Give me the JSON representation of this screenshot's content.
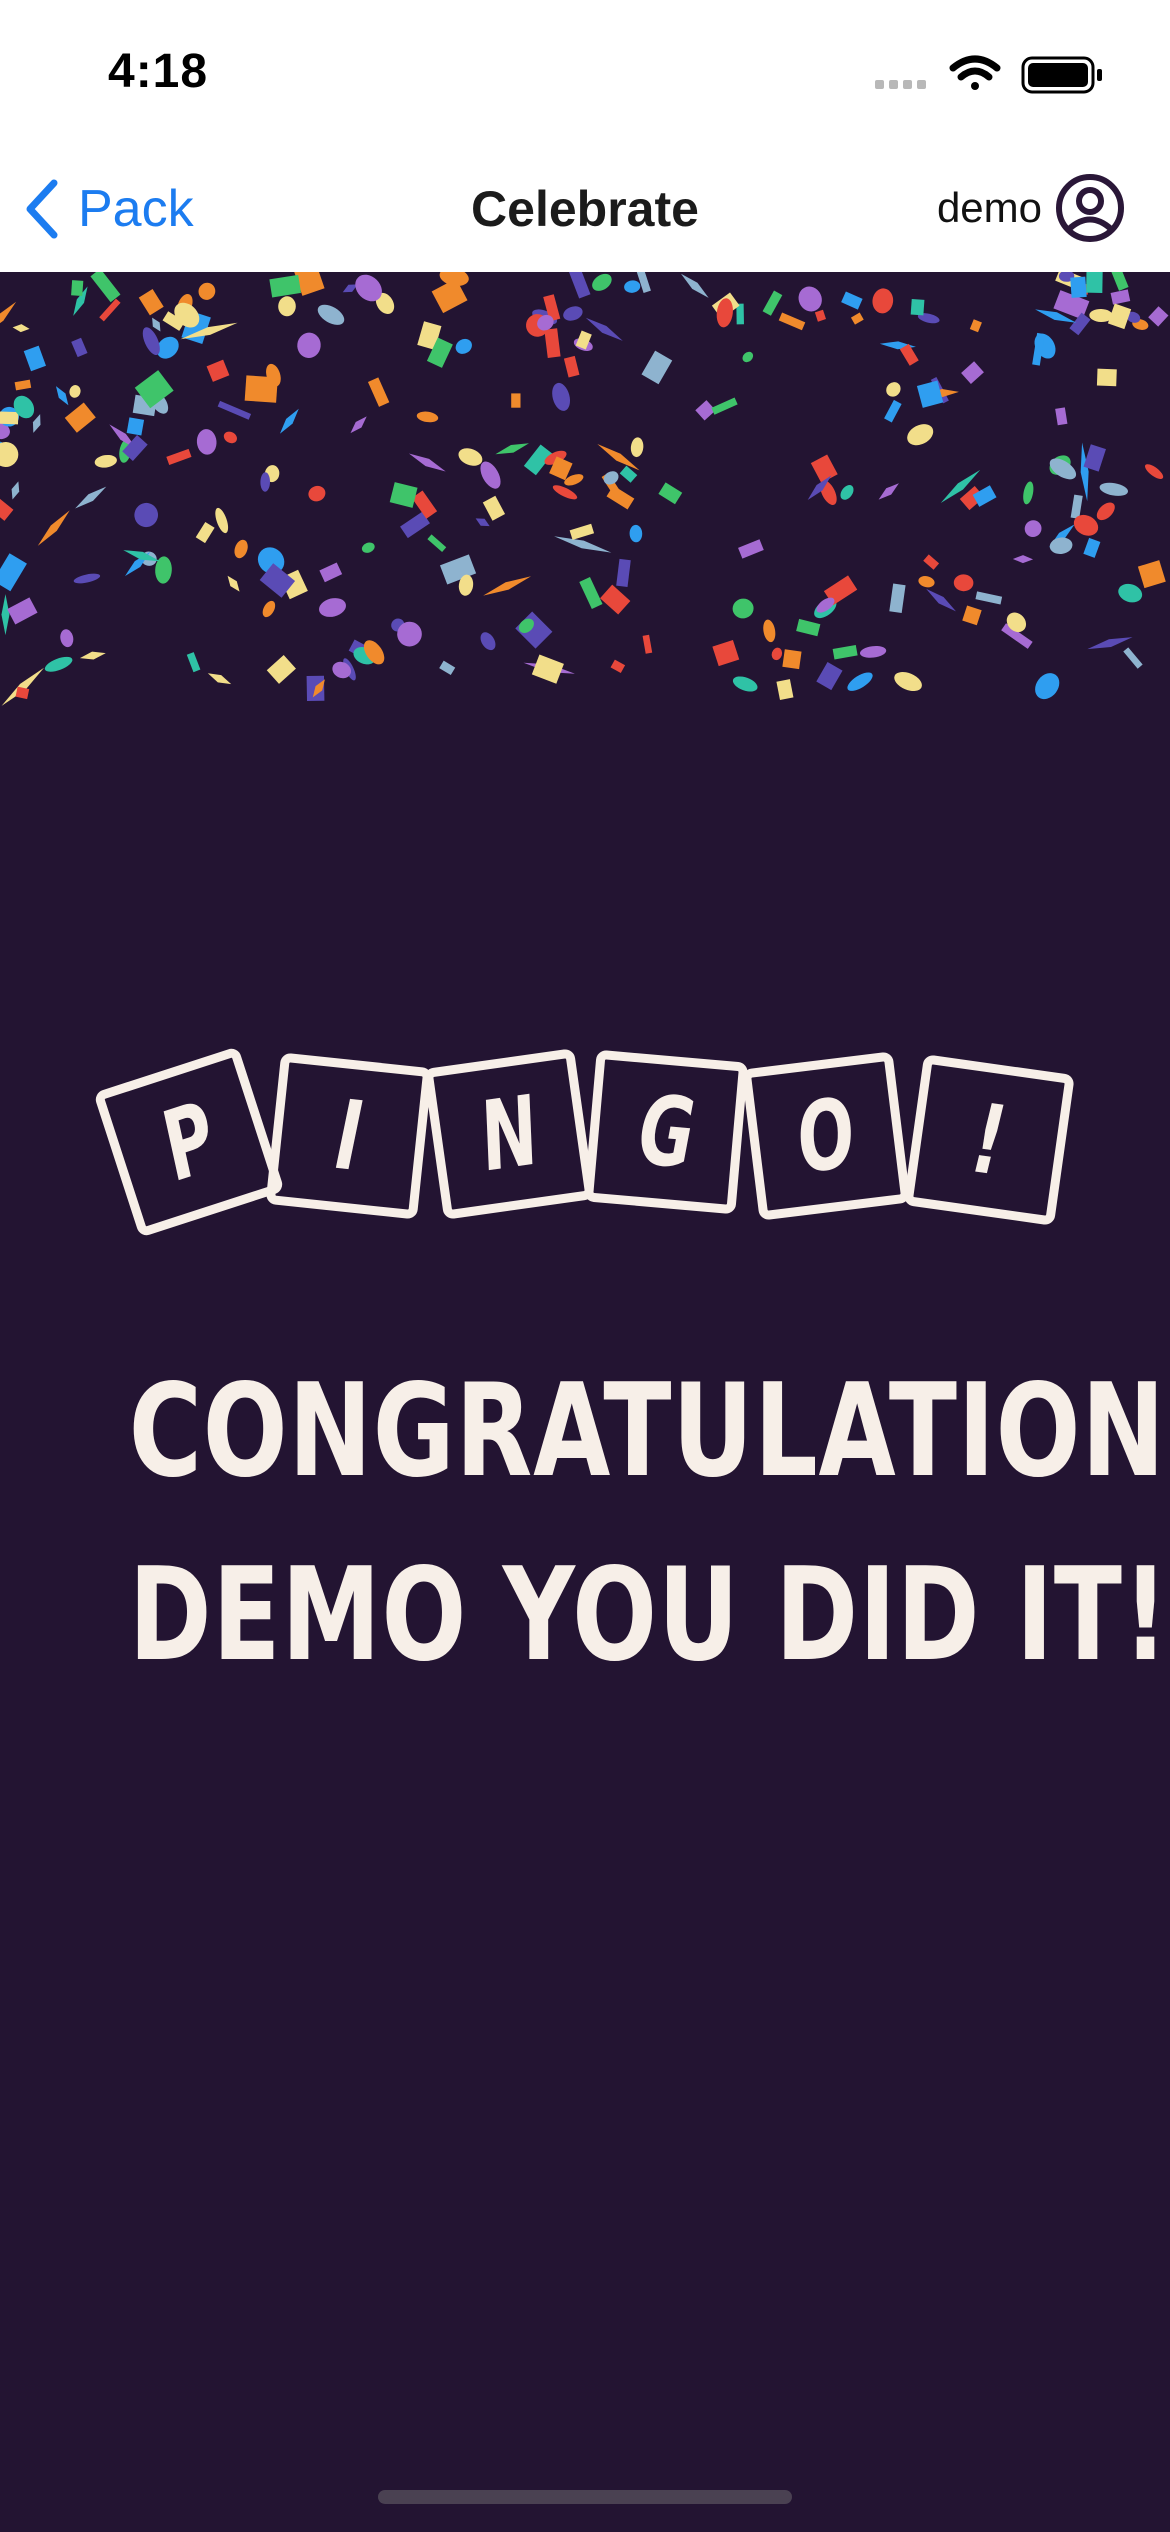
{
  "status_bar": {
    "time": "4:18"
  },
  "nav": {
    "back_label": "Pack",
    "title": "Celebrate",
    "user_name": "demo"
  },
  "logo": {
    "letters": [
      "P",
      "I",
      "N",
      "G",
      "O",
      "!"
    ]
  },
  "congrats": {
    "line1": "CONGRATULATIONS",
    "line2": "DEMO YOU DID IT!"
  },
  "colors": {
    "background": "#231432",
    "accent": "#1c7cf0",
    "text_light": "#f7efe8",
    "confetti": [
      "#e8483b",
      "#f08a2c",
      "#f2de8a",
      "#3fc46a",
      "#2f9ef0",
      "#5a4bb5",
      "#a66bd3",
      "#8eb3cf",
      "#2fc2a6"
    ]
  }
}
